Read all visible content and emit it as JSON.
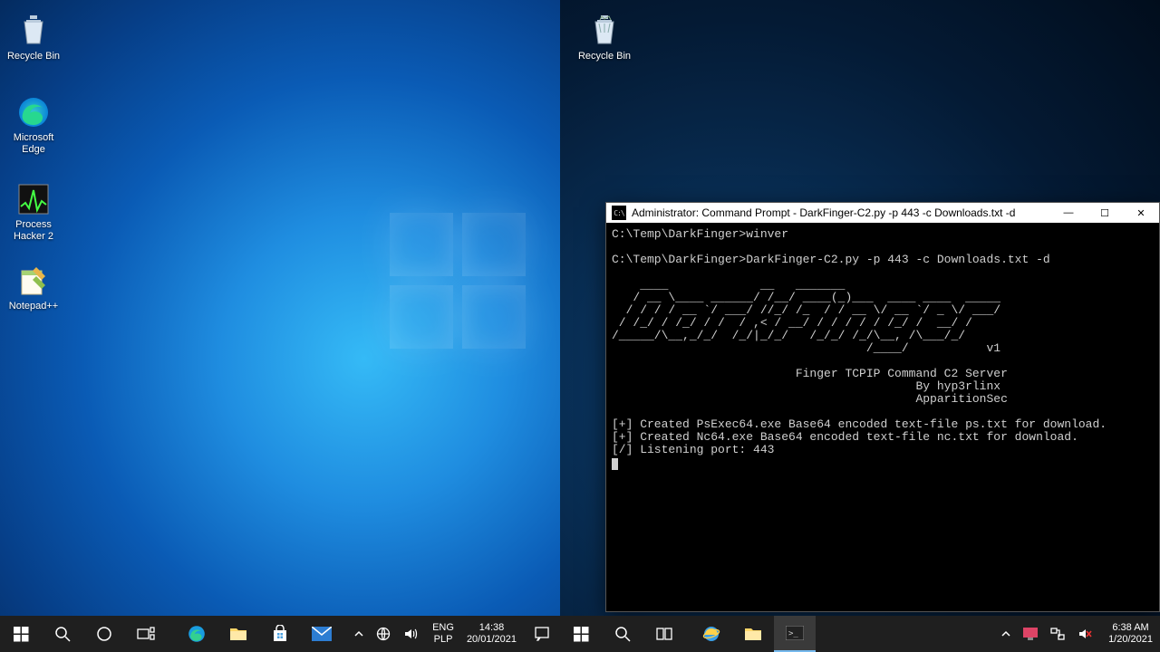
{
  "left": {
    "icons": {
      "recycle": "Recycle Bin",
      "edge1": "Microsoft",
      "edge2": "Edge",
      "ph1": "Process",
      "ph2": "Hacker 2",
      "npp": "Notepad++"
    },
    "taskbar": {
      "lang_top": "ENG",
      "lang_bottom": "PLP",
      "clock_top": "14:38",
      "clock_bottom": "20/01/2021"
    }
  },
  "right": {
    "icons": {
      "recycle": "Recycle Bin"
    },
    "cmd": {
      "title": "Administrator: Command Prompt - DarkFinger-C2.py  -p 443  -c Downloads.txt  -d",
      "line1": "C:\\Temp\\DarkFinger>winver",
      "line2": "C:\\Temp\\DarkFinger>DarkFinger-C2.py -p 443 -c Downloads.txt -d",
      "ascii": "    ____             __   _______\n   / __ \\____ ______/ /__/ ____(_)___  ____ ____  _____\n  / / / / __ `/ ___/ //_/ /_  / / __ \\/ __ `/ _ \\/ ___/\n / /_/ / /_/ / /  / ,< / __/ / / / / / /_/ /  __/ /\n/_____/\\__,_/_/  /_/|_/_/   /_/_/ /_/\\__, /\\___/_/\n                                    /____/           v1",
      "sub1": "                          Finger TCPIP Command C2 Server",
      "sub2": "                                           By hyp3rlinx",
      "sub3": "                                           ApparitionSec",
      "log1": "[+] Created PsExec64.exe Base64 encoded text-file ps.txt for download.",
      "log2": "[+] Created Nc64.exe Base64 encoded text-file nc.txt for download.",
      "log3": "[/] Listening port: 443"
    },
    "taskbar": {
      "clock_top": "6:38 AM",
      "clock_bottom": "1/20/2021"
    }
  }
}
